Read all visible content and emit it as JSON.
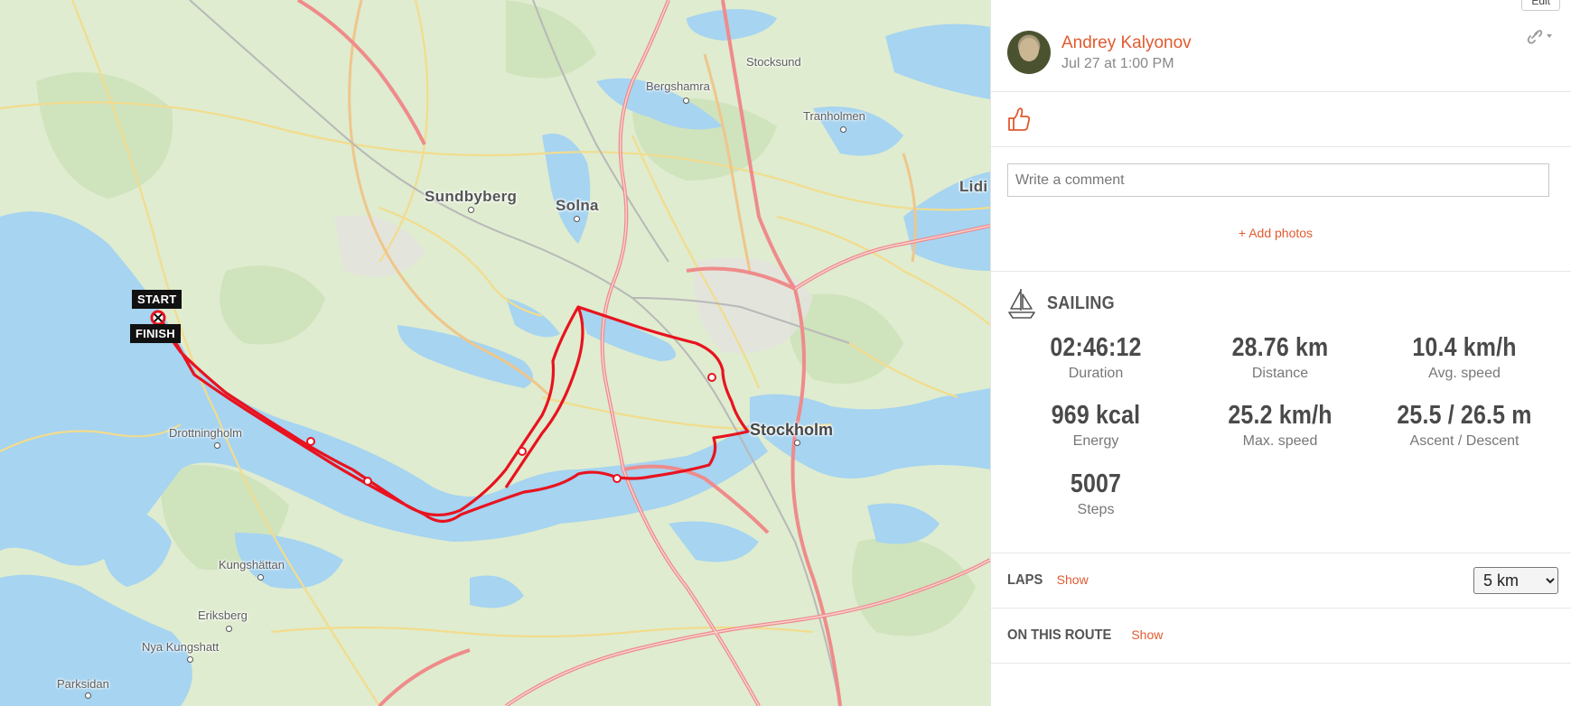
{
  "map": {
    "labels": {
      "stocksund": "Stocksund",
      "bergshamra": "Bergshamra",
      "tranholmen": "Tranholmen",
      "sundbyberg": "Sundbyberg",
      "solna": "Solna",
      "lidingo": "Lidi",
      "drottningholm": "Drottningholm",
      "stockholm": "Stockholm",
      "kungshattan": "Kungshättan",
      "eriksberg": "Eriksberg",
      "nya_kungshatt": "Nya Kungshatt",
      "parksidan": "Parksidan"
    },
    "start_label": "START",
    "finish_label": "FINISH",
    "route_color": "#e8131f",
    "water_color": "#a6d4f1",
    "land_color": "#dfeccf",
    "road_color": "#ef8b8b"
  },
  "panel": {
    "edit_label": "Edit",
    "author_name": "Andrey Kalyonov",
    "date": "Jul 27 at 1:00 PM",
    "comment_placeholder": "Write a comment",
    "add_photos": "+ Add photos",
    "sport": "SAILING",
    "stats": [
      {
        "value": "02:46:12",
        "label": "Duration"
      },
      {
        "value": "28.76 km",
        "label": "Distance"
      },
      {
        "value": "10.4 km/h",
        "label": "Avg. speed"
      },
      {
        "value": "969 kcal",
        "label": "Energy"
      },
      {
        "value": "25.2 km/h",
        "label": "Max. speed"
      },
      {
        "value": "25.5 / 26.5 m",
        "label": "Ascent / Descent"
      },
      {
        "value": "5007",
        "label": "Steps"
      }
    ],
    "laps_title": "LAPS",
    "laps_show": "Show",
    "laps_selected": "5 km",
    "route_title": "ON THIS ROUTE",
    "route_show": "Show",
    "accent": "#e05b30"
  }
}
